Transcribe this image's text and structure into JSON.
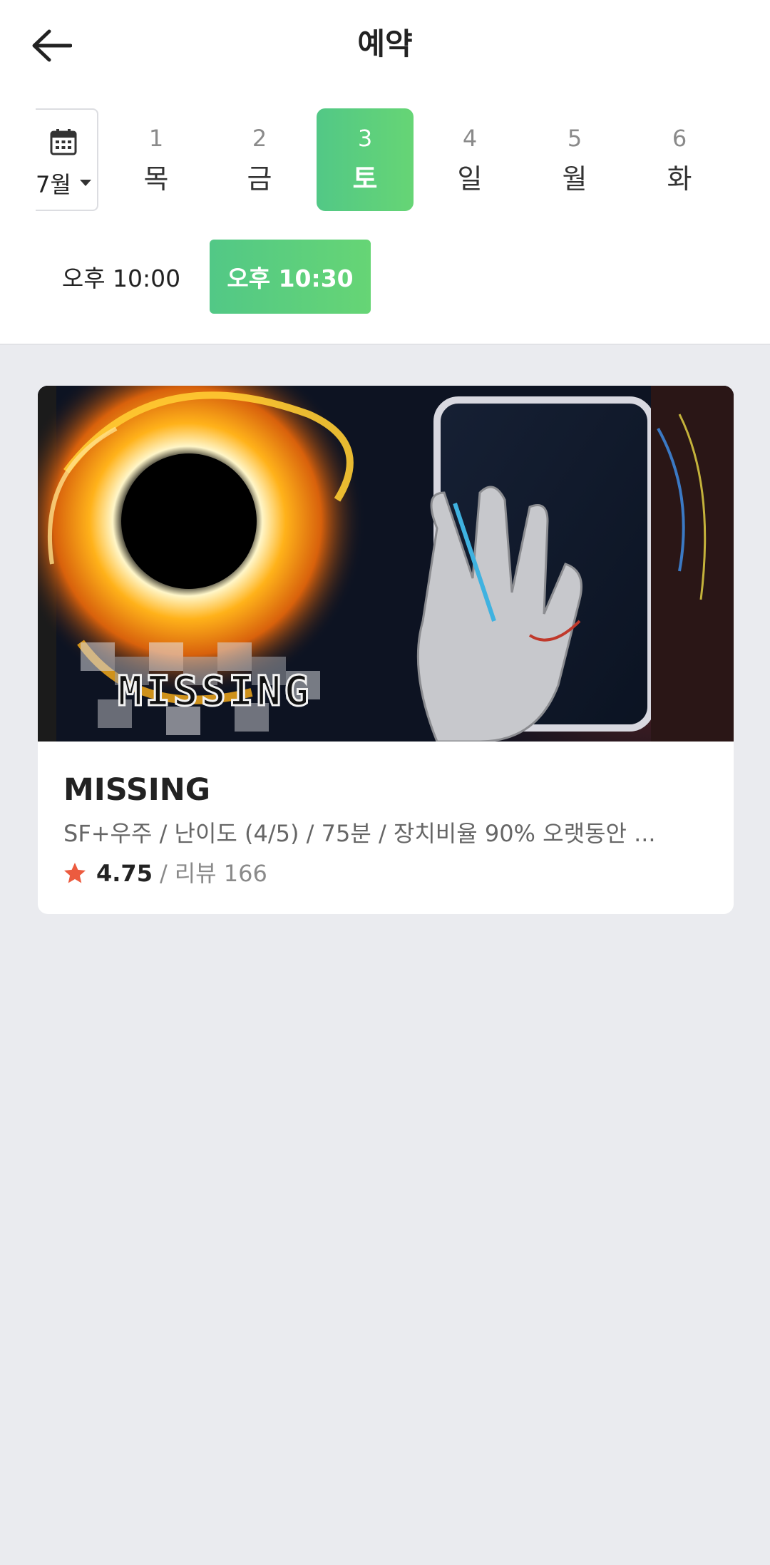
{
  "header": {
    "title": "예약",
    "back_icon": "arrow-left-icon"
  },
  "date_strip": {
    "month_label": "7월",
    "calendar_icon": "calendar-icon",
    "days": [
      {
        "num": "1",
        "weekday": "목",
        "selected": false
      },
      {
        "num": "2",
        "weekday": "금",
        "selected": false
      },
      {
        "num": "3",
        "weekday": "토",
        "selected": true
      },
      {
        "num": "4",
        "weekday": "일",
        "selected": false
      },
      {
        "num": "5",
        "weekday": "월",
        "selected": false
      },
      {
        "num": "6",
        "weekday": "화",
        "selected": false
      }
    ],
    "accent_color": "#5bcf7e"
  },
  "times": [
    {
      "label": "오후 10:00",
      "selected": false
    },
    {
      "label": "오후 10:30",
      "selected": true
    }
  ],
  "theme_card": {
    "poster_text": "MISSING",
    "title": "MISSING",
    "description": "SF+우주 / 난이도 (4/5) / 75분 / 장치비율 90% 오랫동안 ...",
    "rating": "4.75",
    "separator": "/",
    "reviews": "리뷰 166",
    "star_icon": "star-icon",
    "star_color": "#ec5b3f"
  }
}
